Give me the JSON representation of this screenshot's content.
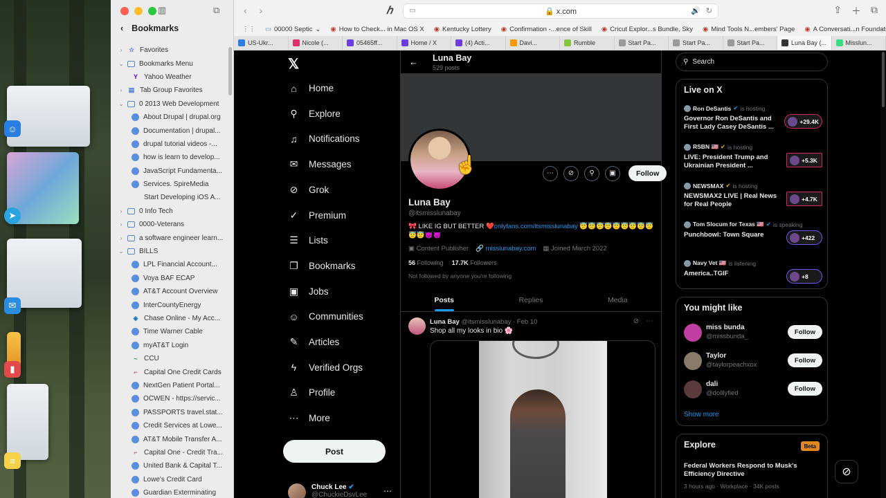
{
  "sidebar": {
    "title": "Bookmarks",
    "items": [
      {
        "label": "Favorites",
        "type": "folder",
        "level": 0,
        "expand": "closed",
        "icon": "star-icon"
      },
      {
        "label": "Bookmarks Menu",
        "type": "folder",
        "level": 0,
        "expand": "open",
        "icon": "folder-icon"
      },
      {
        "label": "Yahoo Weather",
        "type": "link",
        "level": 1,
        "icon": "yahoo-icon"
      },
      {
        "label": "Tab Group Favorites",
        "type": "folder",
        "level": 0,
        "expand": "closed",
        "icon": "tab-group-icon"
      },
      {
        "label": "0 2013 Web Development",
        "type": "folder",
        "level": 0,
        "expand": "open",
        "icon": "folder-icon"
      },
      {
        "label": "About Drupal | drupal.org",
        "type": "link",
        "level": 1,
        "icon": "globe-icon"
      },
      {
        "label": "Documentation | drupal...",
        "type": "link",
        "level": 1,
        "icon": "globe-icon"
      },
      {
        "label": "drupal tutorial videos -...",
        "type": "link",
        "level": 1,
        "icon": "globe-icon"
      },
      {
        "label": "how is learn to develop...",
        "type": "link",
        "level": 1,
        "icon": "globe-icon"
      },
      {
        "label": "JavaScript Fundamenta...",
        "type": "link",
        "level": 1,
        "icon": "globe-icon"
      },
      {
        "label": "Services. SpireMedia",
        "type": "link",
        "level": 1,
        "icon": "globe-icon"
      },
      {
        "label": "Start Developing iOS A...",
        "type": "link",
        "level": 1,
        "icon": "apple-icon"
      },
      {
        "label": "0 Info Tech",
        "type": "folder",
        "level": 0,
        "expand": "closed",
        "icon": "folder-icon"
      },
      {
        "label": "0000-Veterans",
        "type": "folder",
        "level": 0,
        "expand": "closed",
        "icon": "folder-icon"
      },
      {
        "label": "a software engineer learn...",
        "type": "folder",
        "level": 0,
        "expand": "closed",
        "icon": "folder-icon"
      },
      {
        "label": "BILLS",
        "type": "folder",
        "level": 0,
        "expand": "open",
        "icon": "folder-icon"
      },
      {
        "label": "LPL Financial Account...",
        "type": "link",
        "level": 1,
        "icon": "globe-icon"
      },
      {
        "label": "Voya BAF ECAP",
        "type": "link",
        "level": 1,
        "icon": "globe-icon"
      },
      {
        "label": "AT&T Account Overview",
        "type": "link",
        "level": 1,
        "icon": "globe-icon"
      },
      {
        "label": "InterCountyEnergy",
        "type": "link",
        "level": 1,
        "icon": "globe-icon"
      },
      {
        "label": "Chase Online - My Acc...",
        "type": "link",
        "level": 1,
        "icon": "chase-icon"
      },
      {
        "label": "Time Warner Cable",
        "type": "link",
        "level": 1,
        "icon": "globe-icon"
      },
      {
        "label": "myAT&T Login",
        "type": "link",
        "level": 1,
        "icon": "globe-icon"
      },
      {
        "label": "CCU",
        "type": "link",
        "level": 1,
        "icon": "ccu-icon"
      },
      {
        "label": "Capital One Credit Cards",
        "type": "link",
        "level": 1,
        "icon": "capital-one-icon"
      },
      {
        "label": "NextGen Patient Portal...",
        "type": "link",
        "level": 1,
        "icon": "globe-icon"
      },
      {
        "label": "OCWEN - https://servic...",
        "type": "link",
        "level": 1,
        "icon": "globe-icon"
      },
      {
        "label": "PASSPORTS travel.stat...",
        "type": "link",
        "level": 1,
        "icon": "globe-icon"
      },
      {
        "label": "Credit Services at Lowe...",
        "type": "link",
        "level": 1,
        "icon": "globe-icon"
      },
      {
        "label": "AT&T Mobile Transfer A...",
        "type": "link",
        "level": 1,
        "icon": "globe-icon"
      },
      {
        "label": "Capital One - Credit Tra...",
        "type": "link",
        "level": 1,
        "icon": "capital-one-icon"
      },
      {
        "label": "United Bank & Capital T...",
        "type": "link",
        "level": 1,
        "icon": "globe-icon"
      },
      {
        "label": "Lowe's Credit Card",
        "type": "link",
        "level": 1,
        "icon": "globe-icon"
      },
      {
        "label": "Guardian Exterminating",
        "type": "link",
        "level": 1,
        "icon": "globe-icon"
      }
    ]
  },
  "browser": {
    "url": "x.com",
    "favorites_bar": [
      {
        "label": "00000 Septic",
        "icon": "folder-icon",
        "has_menu": true
      },
      {
        "label": "How to Check... in Mac OS X",
        "icon": "page-icon"
      },
      {
        "label": "Kentucky Lottery",
        "icon": "kentucky-icon"
      },
      {
        "label": "Confirmation -...ence of Skill",
        "icon": "sos-icon"
      },
      {
        "label": "Cricut Explor...s Bundle, Sky",
        "icon": "cricut-icon"
      },
      {
        "label": "Mind Tools N...embers' Page",
        "icon": "mindtools-icon"
      },
      {
        "label": "A Conversati...n Foundation",
        "icon": "foundation-icon"
      }
    ],
    "tabs": [
      {
        "label": "US-Ukr...",
        "icon_color": "#2a7de1",
        "active": false
      },
      {
        "label": "Nicole (...",
        "icon_color": "#e1306c",
        "active": false
      },
      {
        "label": "05465ff...",
        "icon_color": "#6a3de8",
        "active": false
      },
      {
        "label": "Home / X",
        "icon_color": "#6a3de8",
        "active": false
      },
      {
        "label": "(4) Acti...",
        "icon_color": "#6a3de8",
        "active": false
      },
      {
        "label": "Davi...",
        "icon_color": "#ff9900",
        "active": false
      },
      {
        "label": "Rumble",
        "icon_color": "#85c742",
        "active": false
      },
      {
        "label": "Start Pa...",
        "icon_color": "#999999",
        "active": false
      },
      {
        "label": "Start Pa...",
        "icon_color": "#999999",
        "active": false
      },
      {
        "label": "Start Pa...",
        "icon_color": "#999999",
        "active": false
      },
      {
        "label": "Luna Bay (...",
        "icon_color": "#333333",
        "active": true
      },
      {
        "label": "Misslun...",
        "icon_color": "#3ddc84",
        "active": false
      }
    ]
  },
  "xnav": {
    "items": [
      {
        "label": "Home",
        "icon": "home-icon",
        "glyph": "⌂"
      },
      {
        "label": "Explore",
        "icon": "search-icon",
        "glyph": "⚲"
      },
      {
        "label": "Notifications",
        "icon": "bell-icon",
        "glyph": "♫"
      },
      {
        "label": "Messages",
        "icon": "mail-icon",
        "glyph": "✉"
      },
      {
        "label": "Grok",
        "icon": "grok-icon",
        "glyph": "⊘"
      },
      {
        "label": "Premium",
        "icon": "verified-icon",
        "glyph": "✓"
      },
      {
        "label": "Lists",
        "icon": "list-icon",
        "glyph": "☰"
      },
      {
        "label": "Bookmarks",
        "icon": "bookmark-icon",
        "glyph": "❐"
      },
      {
        "label": "Jobs",
        "icon": "briefcase-icon",
        "glyph": "▣"
      },
      {
        "label": "Communities",
        "icon": "people-icon",
        "glyph": "☺"
      },
      {
        "label": "Articles",
        "icon": "article-icon",
        "glyph": "✎"
      },
      {
        "label": "Verified Orgs",
        "icon": "lightning-icon",
        "glyph": "ϟ"
      },
      {
        "label": "Profile",
        "icon": "person-icon",
        "glyph": "♙"
      },
      {
        "label": "More",
        "icon": "more-circle-icon",
        "glyph": "⋯"
      }
    ],
    "post_label": "Post",
    "account_name": "Chuck Lee",
    "account_handle": "@ChuckieDsvLee"
  },
  "profile": {
    "name": "Luna Bay",
    "posts_count": "529 posts",
    "handle": "@itsmisslunabay",
    "bio_prefix": "🎀 LIKE IG BUT BETTER ❤️",
    "bio_link": "onlyfans.com/itsmisslunabay",
    "bio_suffix": " 😇😇😇😇😇😇😇😇😇😇😇😈😈",
    "category": "Content Publisher",
    "website": "misslunabay.com",
    "joined": "Joined March 2022",
    "following_count": "56",
    "following_label": "Following",
    "followers_count": "17.7K",
    "followers_label": "Followers",
    "follow_note": "Not followed by anyone you're following",
    "follow_label": "Follow",
    "tabs": [
      "Posts",
      "Replies",
      "Media"
    ],
    "active_tab": "Posts"
  },
  "tweet": {
    "name": "Luna Bay",
    "handle": "@itsmisslunabay",
    "date": "· Feb 10",
    "text": "Shop all my looks in bio 🌸"
  },
  "right": {
    "search_placeholder": "Search",
    "live_title": "Live on X",
    "live": [
      {
        "host": "Ron DeSantis",
        "status": "is hosting",
        "title": "Governor Ron DeSantis and First Lady Casey DeSantis ...",
        "count": "+29.4K",
        "style": "pill",
        "badge": "#1d9bf0"
      },
      {
        "host": "RSBN 🇺🇸",
        "status": "is hosting",
        "title": "LIVE: President Trump and Ukrainian President ...",
        "count": "+5.3K",
        "style": "square",
        "badge": "#e0b400"
      },
      {
        "host": "NEWSMAX",
        "status": "is hosting",
        "title": "NEWSMAX2 LIVE | Real News for Real People",
        "count": "+4.7K",
        "style": "square",
        "badge": "#e0b400"
      },
      {
        "host": "Tom Slocum for Texas 🇺🇸",
        "status": "is speaking",
        "title": "Punchbowl: Town Square",
        "count": "+422",
        "style": "purple",
        "badge": "#1d9bf0"
      },
      {
        "host": "Navy Vet 🇺🇸",
        "status": "is listening",
        "title": "America..TGIF",
        "count": "+8",
        "style": "purple",
        "badge": ""
      }
    ],
    "wtf_title": "You might like",
    "wtf": [
      {
        "name": "miss bunda",
        "handle": "@missbunda_",
        "color": "#c03fa0"
      },
      {
        "name": "Taylor",
        "handle": "@taylorpeachxox",
        "color": "#8a7a6a"
      },
      {
        "name": "dali",
        "handle": "@dolllyfied",
        "color": "#5a3a3a"
      }
    ],
    "follow_label": "Follow",
    "show_more": "Show more",
    "explore_title": "Explore",
    "beta": "Beta",
    "explore_item_title": "Federal Workers Respond to Musk's Efficiency Directive",
    "explore_item_meta": "3 hours ago · Workplace · 34K posts"
  }
}
